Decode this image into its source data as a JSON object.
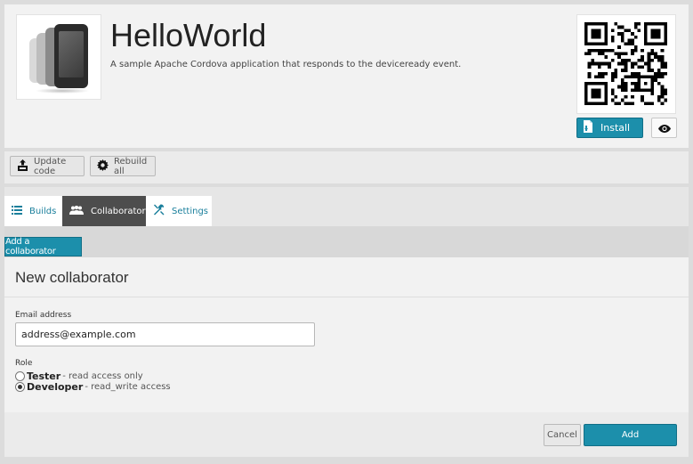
{
  "app": {
    "title": "HelloWorld",
    "description": "A sample Apache Cordova application that responds to the deviceready event."
  },
  "header": {
    "install_label": "Install"
  },
  "toolbar": {
    "update_code_label": "Update code",
    "rebuild_all_label": "Rebuild all"
  },
  "tabs": [
    {
      "label": "Builds",
      "icon": "list-icon",
      "active": false
    },
    {
      "label": "Collaborators",
      "icon": "people-icon",
      "active": true
    },
    {
      "label": "Settings",
      "icon": "tools-icon",
      "active": false
    }
  ],
  "collaborators": {
    "add_button_label": "Add a collaborator"
  },
  "form": {
    "title": "New collaborator",
    "email_label": "Email address",
    "email_value": "address@example.com",
    "role_label": "Role",
    "roles": [
      {
        "name": "Tester",
        "description": " - read access only",
        "checked": false
      },
      {
        "name": "Developer",
        "description": " - read_write access",
        "checked": true
      }
    ],
    "cancel_label": "Cancel",
    "add_label": "Add"
  },
  "colors": {
    "accent": "#1c8fab",
    "active_tab": "#4d4d4d"
  }
}
